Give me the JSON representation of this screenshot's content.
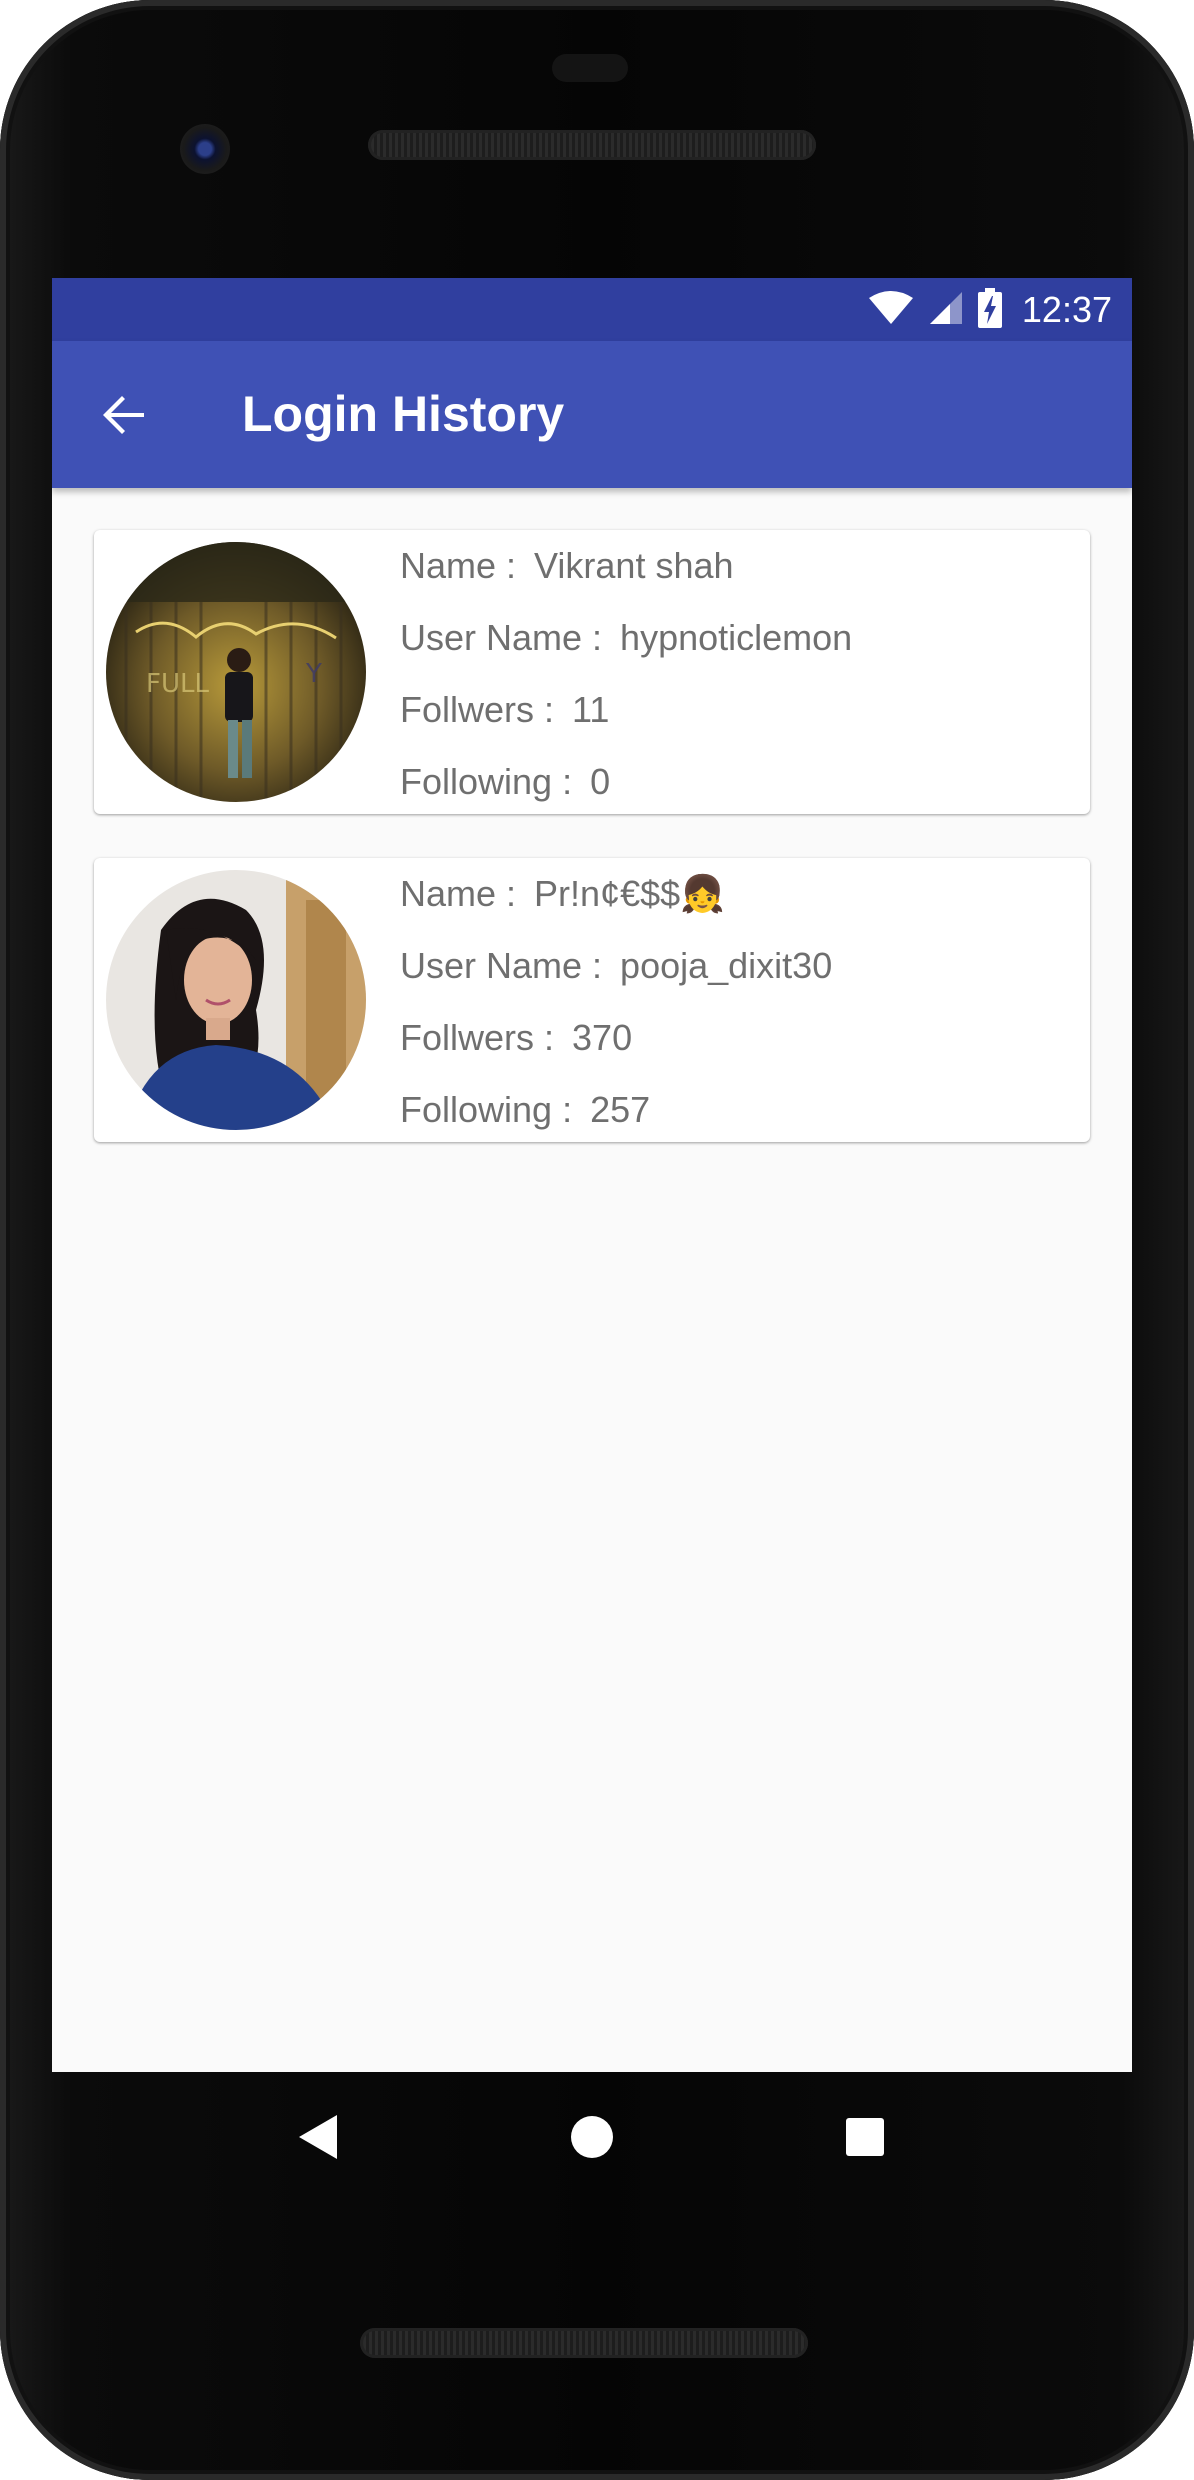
{
  "status_bar": {
    "time": "12:37",
    "icons": [
      "wifi-icon",
      "signal-icon",
      "battery-charging-icon"
    ],
    "background": "#303f9f"
  },
  "app_bar": {
    "title": "Login History",
    "back_icon": "arrow-back-icon",
    "background": "#3f51b5"
  },
  "labels": {
    "name": "Name :",
    "username": "User Name :",
    "followers": "Follwers :",
    "following": "Following :"
  },
  "users": [
    {
      "name": "Vikrant shah",
      "username": "hypnoticlemon",
      "followers": "11",
      "following": "0"
    },
    {
      "name": "Pr!n¢€$$👧",
      "username": "pooja_dixit30",
      "followers": "370",
      "following": "257"
    }
  ],
  "nav": {
    "icons": [
      "back-triangle-icon",
      "home-circle-icon",
      "recents-square-icon"
    ]
  }
}
